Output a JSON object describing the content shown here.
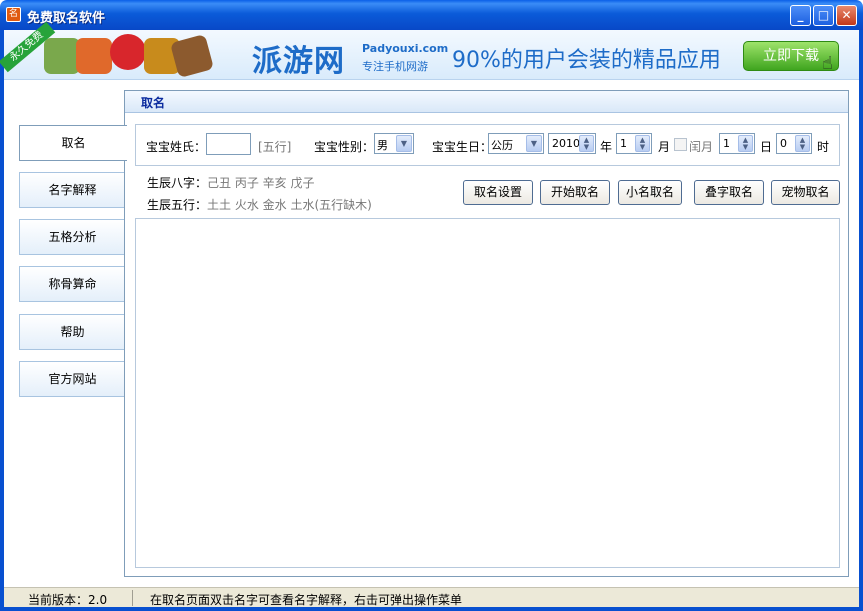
{
  "window": {
    "title": "免费取名软件",
    "app_icon": "名",
    "min_glyph": "_",
    "max_glyph": "□",
    "close_glyph": "✕"
  },
  "banner": {
    "ribbon": "永久免费",
    "logo": "派游网",
    "logo_en": "Padyouxi.com",
    "logo_sub": "专注手机网游",
    "slogan": "90%的用户会装的精品应用",
    "download_label": "立即下载"
  },
  "sidebar": {
    "tabs": [
      {
        "label": "取名"
      },
      {
        "label": "名字解释"
      },
      {
        "label": "五格分析"
      },
      {
        "label": "称骨算命"
      },
      {
        "label": "帮助"
      },
      {
        "label": "官方网站"
      }
    ]
  },
  "panel": {
    "title": "取名"
  },
  "form": {
    "surname_label": "宝宝姓氏：",
    "surname_value": "",
    "wuxing_hint": "[五行]",
    "gender_label": "宝宝性别：",
    "gender_value": "男",
    "birth_label": "宝宝生日：",
    "calendar_value": "公历",
    "year_value": "2010",
    "year_unit": "年",
    "month_value": "1",
    "month_unit": "月",
    "leap_label": "闰月",
    "day_value": "1",
    "day_unit": "日",
    "hour_value": "0",
    "hour_unit": "时"
  },
  "info": {
    "bazi_label": "生辰八字：",
    "bazi_value": "己丑 丙子 辛亥 戊子",
    "wuxing_label": "生辰五行：",
    "wuxing_value": "土土 火水 金水 土水(五行缺木)"
  },
  "actions": {
    "settings": "取名设置",
    "start": "开始取名",
    "nickname": "小名取名",
    "repeat": "叠字取名",
    "pet": "宠物取名"
  },
  "statusbar": {
    "version": "当前版本：2.0",
    "tip": "在取名页面双击名字可查看名字解释，右击可弹出操作菜单"
  },
  "colors": {
    "titlebar": "#0a5fe8",
    "panel_title": "#0b2b9e",
    "download": "#3fa51f",
    "brand": "#1e6cc8"
  }
}
